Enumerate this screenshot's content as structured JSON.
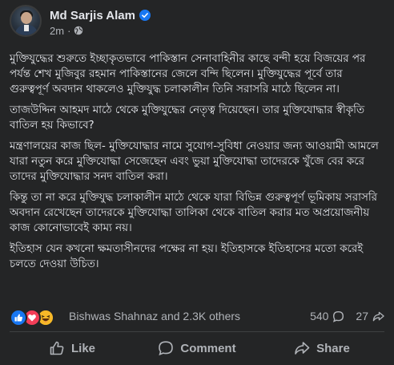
{
  "post": {
    "author": {
      "name": "Md Sarjis Alam",
      "verified_icon": "verified-badge-icon",
      "time": "2m",
      "separator": "·",
      "audience_icon": "globe-icon"
    },
    "paragraphs": [
      "মুক্তিযুদ্ধের শুরুতে ইচ্ছাকৃতভাবে পাকিস্তান সেনাবাহিনীর কাছে বন্দী হয়ে বিজয়ের পর পর্যন্ত শেখ মুজিবুর রহমান পাকিস্তানের জেলে বন্দি ছিলেন। মুক্তিযুদ্ধের পূর্বে তার গুরুত্বপূর্ণ অবদান থাকলেও মুক্তিযুদ্ধ চলাকালীন তিনি সরাসরি মাঠে ছিলেন না।",
      "তাজউদ্দিন আহমদ মাঠে থেকে মুক্তিযুদ্ধের নেতৃত্ব দিয়েছেন। তার মুক্তিযোদ্ধার স্বীকৃতি বাতিল হয় কিভাবে?",
      "মন্ত্রণালয়ের কাজ ছিল- মুক্তিযোদ্ধার নামে সুযোগ-সুবিধা নেওয়ার জন্য আওয়ামী আমলে যারা নতুন করে মুক্তিযোদ্ধা সেজেছেন এবং ভুয়া মুক্তিযোদ্ধা তাদেরকে খুঁজে বের করে তাদের মুক্তিযোদ্ধার সনদ বাতিল করা।",
      "কিন্তু তা না করে মুক্তিযুদ্ধ চলাকালীন মাঠে থেকে যারা বিভিন্ন গুরুত্বপূর্ণ ভূমিকায় সরাসরি অবদান রেখেছেন তাদেরকে মুক্তিযোদ্ধা তালিকা থেকে বাতিল করার মত অপ্রয়োজনীয় কাজ কোনোভাবেই কাম্য নয়।",
      "ইতিহাস যেন কখনো ক্ষমতাসীনদের পক্ষের না হয়। ইতিহাসকে ইতিহাসের মতো করেই চলতে দেওয়া উচিত।"
    ],
    "reactions": {
      "icons": [
        "like-reaction-icon",
        "love-reaction-icon",
        "haha-reaction-icon"
      ],
      "summary": "Bishwas Shahnaz and 2.3K others",
      "comments_count": "540",
      "comments_icon": "comment-count-icon",
      "shares_count": "27",
      "shares_icon": "share-count-icon"
    },
    "actions": {
      "like_label": "Like",
      "comment_label": "Comment",
      "share_label": "Share"
    }
  },
  "colors": {
    "background": "#242526",
    "text_primary": "#e4e6eb",
    "text_secondary": "#b0b3b8",
    "accent_blue": "#1877f2",
    "love_red": "#f33e58",
    "haha_yellow": "#f7b928",
    "divider": "#3e4042"
  }
}
